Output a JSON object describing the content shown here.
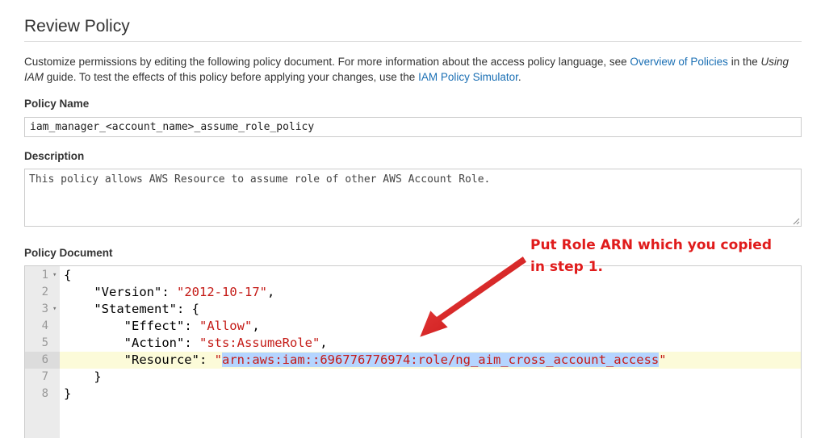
{
  "header": {
    "title": "Review Policy"
  },
  "intro": {
    "text1": "Customize permissions by editing the following policy document. For more information about the access policy language, see ",
    "link1": "Overview of Policies",
    "text2": " in the ",
    "italic": "Using IAM",
    "text3": " guide. To test the effects of this policy before applying your changes, use the ",
    "link2": "IAM Policy Simulator",
    "text4": "."
  },
  "policy_name": {
    "label": "Policy Name",
    "value": "iam_manager_<account_name>_assume_role_policy"
  },
  "description": {
    "label": "Description",
    "value": "This policy allows AWS Resource to assume role of other AWS Account Role."
  },
  "policy_document": {
    "label": "Policy Document",
    "lines": [
      {
        "num": "1",
        "text": "{"
      },
      {
        "num": "2",
        "key": "\"Version\"",
        "value": "\"2012-10-17\""
      },
      {
        "num": "3",
        "key": "\"Statement\"",
        "text": "{"
      },
      {
        "num": "4",
        "key": "\"Effect\"",
        "value": "\"Allow\""
      },
      {
        "num": "5",
        "key": "\"Action\"",
        "value": "\"sts:AssumeRole\""
      },
      {
        "num": "6",
        "key": "\"Resource\"",
        "quote_open": "\"",
        "selected": "arn:aws:iam::696776776974:role/ng_aim_cross_account_access",
        "quote_close": "\""
      },
      {
        "num": "7",
        "text": "}"
      },
      {
        "num": "8",
        "text": "}"
      }
    ]
  },
  "annotation": {
    "line1": "Put Role ARN which you copied",
    "line2": "in step 1."
  },
  "colors": {
    "link": "#1a6fb4",
    "string": "#c41a16",
    "selection": "#b5d5ff",
    "active_line": "#fcfbd9",
    "annotation": "#e01b1b"
  }
}
